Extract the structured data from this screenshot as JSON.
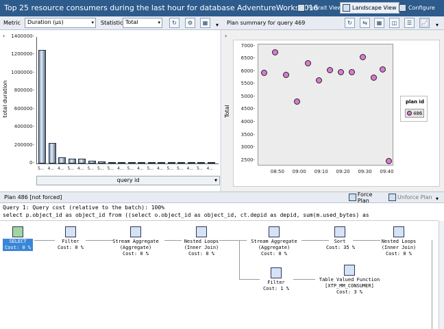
{
  "window": {
    "title": "Top 25 resource consumers during the last hour for database AdventureWorks2016"
  },
  "toolbar": {
    "portrait_label": "Portrait View",
    "landscape_label": "Landscape View",
    "configure_label": "Configure"
  },
  "left_panel": {
    "metric_label": "Metric",
    "metric_value": "Duration (µs)",
    "statistic_label": "Statistic",
    "statistic_value": "Total"
  },
  "right_panel": {
    "title": "Plan summary for query 469"
  },
  "chart_data": [
    {
      "type": "bar",
      "ylabel": "total duration",
      "xlabel": "query id",
      "ylim": [
        0,
        1400000
      ],
      "yticks": [
        "0",
        "200000",
        "400000",
        "600000",
        "800000",
        "1000000",
        "1200000",
        "1400000"
      ],
      "categories": [
        "5...",
        "4...",
        "4...",
        "5...",
        "4...",
        "5...",
        "5...",
        "5...",
        "4...",
        "5...",
        "4...",
        "5...",
        "4...",
        "5...",
        "5...",
        "4...",
        "5...",
        "4..."
      ],
      "values": [
        1260000,
        225000,
        65000,
        55000,
        50000,
        32000,
        25000,
        18000,
        14000,
        11000,
        9000,
        8000,
        7500,
        7000,
        6500,
        6000,
        5500,
        5000
      ]
    },
    {
      "type": "scatter",
      "ylabel": "Total",
      "ylim": [
        2300,
        7100
      ],
      "yticks": [
        "2500",
        "3000",
        "3500",
        "4000",
        "4500",
        "5000",
        "5500",
        "6000",
        "6500",
        "7000"
      ],
      "xticks": [
        "08:50",
        "09:00",
        "09:10",
        "09:20",
        "09:30",
        "09:40"
      ],
      "series": [
        {
          "name": "486",
          "points": [
            [
              "08:44",
              5950
            ],
            [
              "08:49",
              6750
            ],
            [
              "08:54",
              5870
            ],
            [
              "08:59",
              4830
            ],
            [
              "09:04",
              6320
            ],
            [
              "09:09",
              5660
            ],
            [
              "09:14",
              6050
            ],
            [
              "09:19",
              5980
            ],
            [
              "09:24",
              5970
            ],
            [
              "09:29",
              6570
            ],
            [
              "09:34",
              5770
            ],
            [
              "09:38",
              6080
            ],
            [
              "09:41",
              2470
            ]
          ]
        }
      ],
      "legend": {
        "title": "plan id",
        "placement": "right"
      }
    }
  ],
  "plan_bar": {
    "plan_label": "Plan 486 [not forced]",
    "force_label": "Force Plan",
    "unforce_label": "Unforce Plan"
  },
  "query_text": {
    "line1": "Query 1: Query cost (relative to the batch): 100%",
    "line2": "select p.object_id as object_id from ((select o.object_id as object_id, ct.depid as depid, sum(m.used_bytes) as"
  },
  "plan_nodes": [
    {
      "l1": "SELECT",
      "l2": "Cost: 0 %"
    },
    {
      "l1": "Filter",
      "l2": "Cost: 0 %"
    },
    {
      "l1": "Stream Aggregate",
      "l2": "(Aggregate)",
      "l3": "Cost: 0 %"
    },
    {
      "l1": "Nested Loops",
      "l2": "(Inner Join)",
      "l3": "Cost: 0 %"
    },
    {
      "l1": "Stream Aggregate",
      "l2": "(Aggregate)",
      "l3": "Cost: 0 %"
    },
    {
      "l1": "Sort",
      "l2": "Cost: 35 %"
    },
    {
      "l1": "Nested Loops",
      "l2": "(Inner Join)",
      "l3": "Cost: 0 %"
    },
    {
      "l1": "Filter",
      "l2": "Cost: 1 %"
    },
    {
      "l1": "Table Valued Function",
      "l2": "[XTP_MM_CONSUMER]",
      "l3": "Cost: 3 %"
    }
  ]
}
